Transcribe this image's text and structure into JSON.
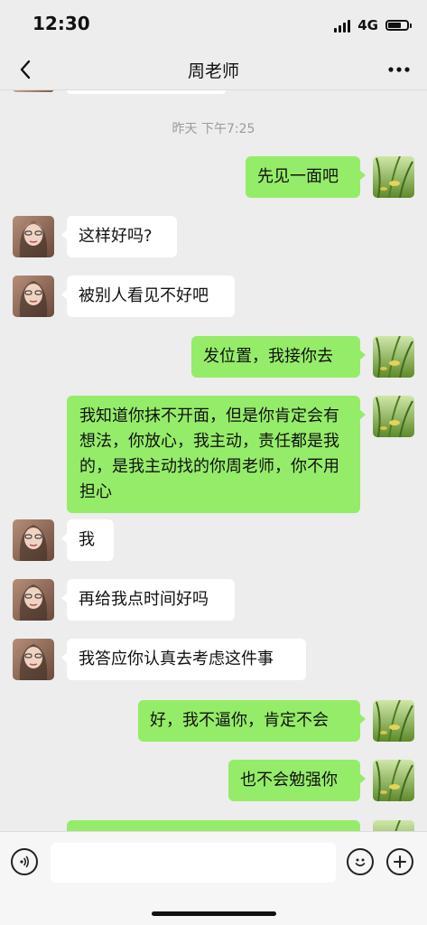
{
  "status_bar": {
    "time": "12:30",
    "network": "4G",
    "icons": [
      "signal-icon",
      "battery-icon"
    ]
  },
  "header": {
    "title": "周老师",
    "back_icon": "chevron-left-icon",
    "more_icon": "more-icon"
  },
  "chat": {
    "timestamp": "昨天 下午7:25",
    "messages": [
      {
        "side": "out",
        "text": "先见一面吧"
      },
      {
        "side": "in",
        "text": "这样好吗?"
      },
      {
        "side": "in",
        "text": "被别人看见不好吧"
      },
      {
        "side": "out",
        "text": "发位置，我接你去"
      },
      {
        "side": "out",
        "text": "我知道你抹不开面，但是你肯定会有想法，你放心，我主动，责任都是我的，是我主动找的你周老师，你不用担心"
      },
      {
        "side": "in",
        "text": "我"
      },
      {
        "side": "in",
        "text": "再给我点时间好吗"
      },
      {
        "side": "in",
        "text": "我答应你认真去考虑这件事"
      },
      {
        "side": "out",
        "text": "好，我不逼你，肯定不会"
      },
      {
        "side": "out",
        "text": "也不会勉强你"
      },
      {
        "side": "out",
        "text": ""
      }
    ]
  },
  "input_bar": {
    "placeholder": "",
    "icons": [
      "voice-icon",
      "emoji-icon",
      "plus-icon"
    ]
  },
  "colors": {
    "background": "#ededed",
    "outgoing_bubble": "#95ec69",
    "incoming_bubble": "#ffffff",
    "timestamp_text": "#9b9b9b"
  }
}
